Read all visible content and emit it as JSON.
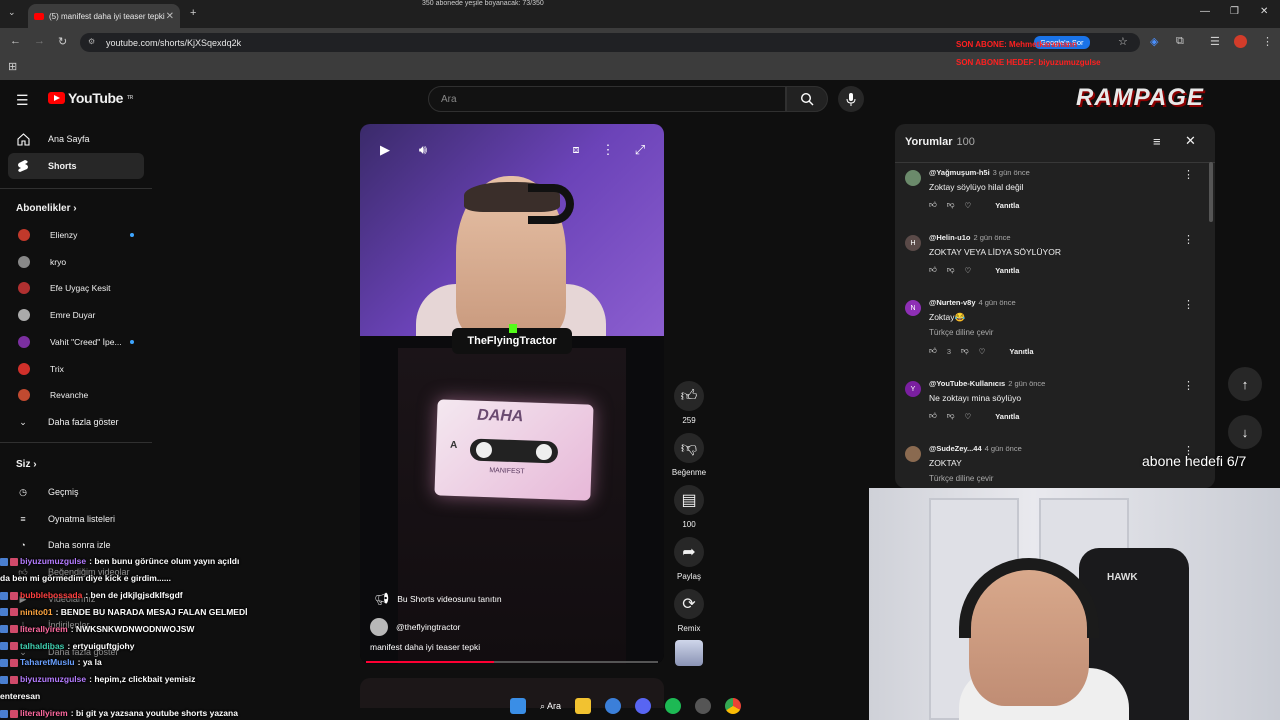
{
  "browser": {
    "tab_title": "(5) manifest daha iyi teaser tepki",
    "url": "youtube.com/shorts/KjXSqexdq2k",
    "google_chip": "Google'a Sor",
    "overlay_top": "350 abonede yeşile boyanacak: 73/350"
  },
  "header": {
    "logo": "YouTube",
    "region": "TR",
    "search_placeholder": "Ara"
  },
  "sidebar": {
    "home": "Ana Sayfa",
    "shorts": "Shorts",
    "subscriptions_title": "Abonelikler",
    "subscriptions": [
      {
        "name": "Elienzy",
        "dot": true,
        "color": "#c0392b"
      },
      {
        "name": "kryo",
        "dot": false,
        "color": "#888888"
      },
      {
        "name": "Efe Uygaç Kesit",
        "dot": false,
        "color": "#b03030"
      },
      {
        "name": "Emre Duyar",
        "dot": false,
        "color": "#aaaaaa"
      },
      {
        "name": "Vahit \"Creed\" İpe...",
        "dot": true,
        "color": "#7b2fa0"
      },
      {
        "name": "Trix",
        "dot": false,
        "color": "#d0302a"
      },
      {
        "name": "Revanche",
        "dot": false,
        "color": "#c04a30"
      }
    ],
    "show_more": "Daha fazla göster",
    "you_title": "Siz",
    "history": "Geçmiş",
    "playlists": "Oynatma listeleri",
    "watch_later": "Daha sonra izle",
    "liked": "Beğendiğim videolar",
    "your_videos": "Videolarınız",
    "downloads": "İndirilenler",
    "show_more_2": "Daha fazla göster"
  },
  "video": {
    "overlay_name": "TheFlyingTractor",
    "promo": "Bu Shorts videosunu tanıtın",
    "channel": "@theflyingtractor",
    "title": "manifest daha iyi teaser tepki",
    "cassette_text": "DAHA",
    "cassette_brand": "MANIFEST",
    "progress": 0.44
  },
  "actions": {
    "likes": "259",
    "dislike": "Beğenme",
    "comments": "100",
    "share": "Paylaş",
    "remix": "Remix"
  },
  "comments_panel": {
    "title": "Yorumlar",
    "count": "100",
    "reply_label": "Yanıtla",
    "translate_label": "Türkçe diline çevir",
    "items": [
      {
        "author": "@Yağmuşum-h5i",
        "age": "3 gün önce",
        "text": "Zoktay söylüyo hilal değil",
        "likes": "",
        "initial": "",
        "color": "#6b8a6b",
        "translate": false
      },
      {
        "author": "@Helin-u1o",
        "age": "2 gün önce",
        "text": "ZOKTAY VEYA LİDYA SÖYLÜYOR",
        "likes": "",
        "initial": "H",
        "color": "#5a4a48",
        "translate": false
      },
      {
        "author": "@Nurten-v8y",
        "age": "4 gün önce",
        "text": "Zoktay😂",
        "likes": "3",
        "initial": "N",
        "color": "#8e2fb5",
        "translate": true
      },
      {
        "author": "@YouTube-Kullanıcıs",
        "age": "2 gün önce",
        "text": "Ne zoktayı mina söylüyo",
        "likes": "",
        "initial": "Y",
        "color": "#7a1fa0",
        "translate": false
      },
      {
        "author": "@SudeZey...44",
        "age": "4 gün önce",
        "text": "ZOKTAY",
        "likes": "",
        "initial": "",
        "color": "#8a6a50",
        "translate": true
      }
    ]
  },
  "stream": {
    "goal": "abone hedefi 6/7",
    "brand": "RAMPAGE",
    "red_line_1": "SON ABONE: Mehmetkaramann",
    "red_line_2": "SON ABONE HEDEF: biyuzumuzgulse"
  },
  "chat": [
    {
      "user": "biyuzumuzgulse",
      "msg": ": ben bunu görünce olum yayın açıldı",
      "color": "#b57cff"
    },
    {
      "user": "",
      "msg": "da ben mi görmedim diye kick e girdim......",
      "color": "#ffffff"
    },
    {
      "user": "bubblebossada",
      "msg": ": ben de jdkjlgjsdklfsgdf",
      "color": "#ff4040"
    },
    {
      "user": "ninito01",
      "msg": ": BENDE BU NARADA MESAJ FALAN GELMEDİ",
      "color": "#ffa640"
    },
    {
      "user": "literallyirem",
      "msg": ": NWKSNKWDNWODNWOJSW",
      "color": "#ff6aa0"
    },
    {
      "user": "talhaldibas",
      "msg": ": ertyuiguftgjohy",
      "color": "#40d0b0"
    },
    {
      "user": "TaharetMuslu",
      "msg": ": ya la",
      "color": "#6aa0ff"
    },
    {
      "user": "biyuzumuzgulse",
      "msg": ": hepim,z clickbait yemisiz",
      "color": "#b57cff"
    },
    {
      "user": "",
      "msg": "enteresan",
      "color": "#ffffff"
    },
    {
      "user": "literallyirem",
      "msg": ": bi git ya yazsana youtube shorts yazana",
      "color": "#ff6aa0"
    }
  ],
  "taskbar": {
    "search": "Ara"
  },
  "colors": {
    "accent_red": "#ff0000",
    "link_blue": "#3ea6ff",
    "bg": "#0f0f0f"
  }
}
